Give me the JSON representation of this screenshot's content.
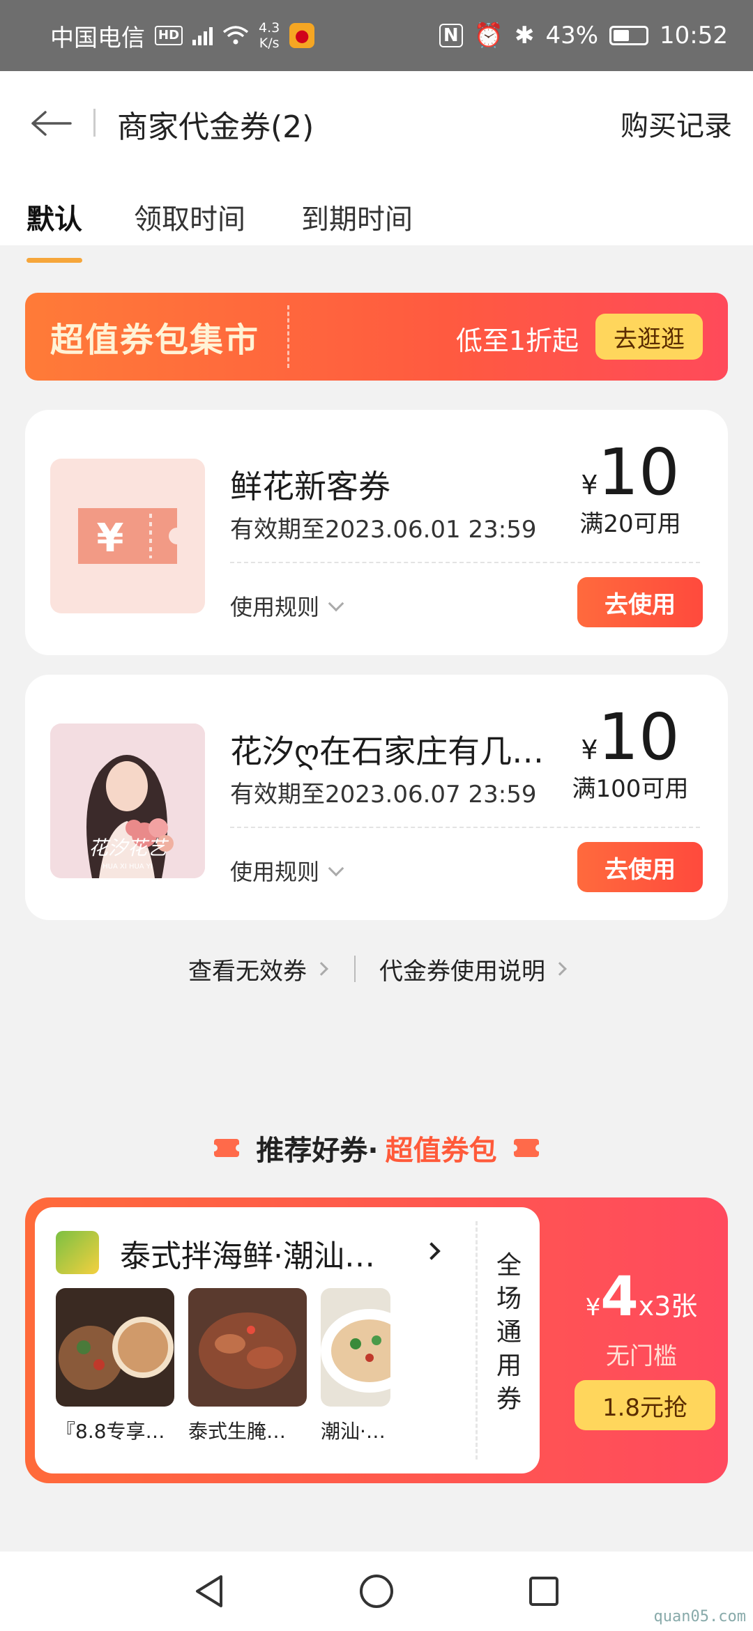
{
  "status_bar": {
    "carrier": "中国电信",
    "hd": "HD",
    "net_speed_value": "4.3",
    "net_speed_unit": "K/s",
    "nfc_label": "N",
    "battery": "43%",
    "time": "10:52"
  },
  "header": {
    "title": "商家代金券(2)",
    "purchase_records": "购买记录"
  },
  "tabs": [
    {
      "label": "默认",
      "active": true
    },
    {
      "label": "领取时间",
      "active": false
    },
    {
      "label": "到期时间",
      "active": false
    }
  ],
  "market_banner": {
    "title": "超值券包集市",
    "subtitle": "低至1折起",
    "button": "去逛逛"
  },
  "vouchers": [
    {
      "name": "鲜花新客券",
      "expiry": "有效期至2023.06.01 23:59",
      "currency": "¥",
      "amount": "10",
      "condition": "满20可用",
      "rules_label": "使用规则",
      "use_button": "去使用",
      "thumb_icon": "coupon-yen-icon"
    },
    {
      "name": "花汐ღ在石家庄有几…",
      "expiry": "有效期至2023.06.07 23:59",
      "currency": "¥",
      "amount": "10",
      "condition": "满100可用",
      "rules_label": "使用规则",
      "use_button": "去使用",
      "thumb_text": "花汐花艺",
      "thumb_subtext": "HUA XI HUA YI"
    }
  ],
  "links": {
    "invalid": "查看无效券",
    "instructions": "代金券使用说明"
  },
  "recommend": {
    "title_prefix": "推荐好券·",
    "title_highlight": "超值券包"
  },
  "pack": {
    "shop_name": "泰式拌海鲜·潮汕…",
    "items": [
      {
        "label": "『8.8专享…"
      },
      {
        "label": "泰式生腌…"
      },
      {
        "label": "潮汕·腌生…"
      }
    ],
    "scope_chars": [
      "全",
      "场",
      "通",
      "用",
      "券"
    ],
    "currency": "¥",
    "amount": "4",
    "count": "x3张",
    "threshold": "无门槛",
    "buy_button": "1.8元抢"
  },
  "watermark": "quan05.com",
  "colors": {
    "accent_orange": "#ff5a3a",
    "tab_indicator": "#f6a63b",
    "button_yellow": "#ffd65c"
  }
}
